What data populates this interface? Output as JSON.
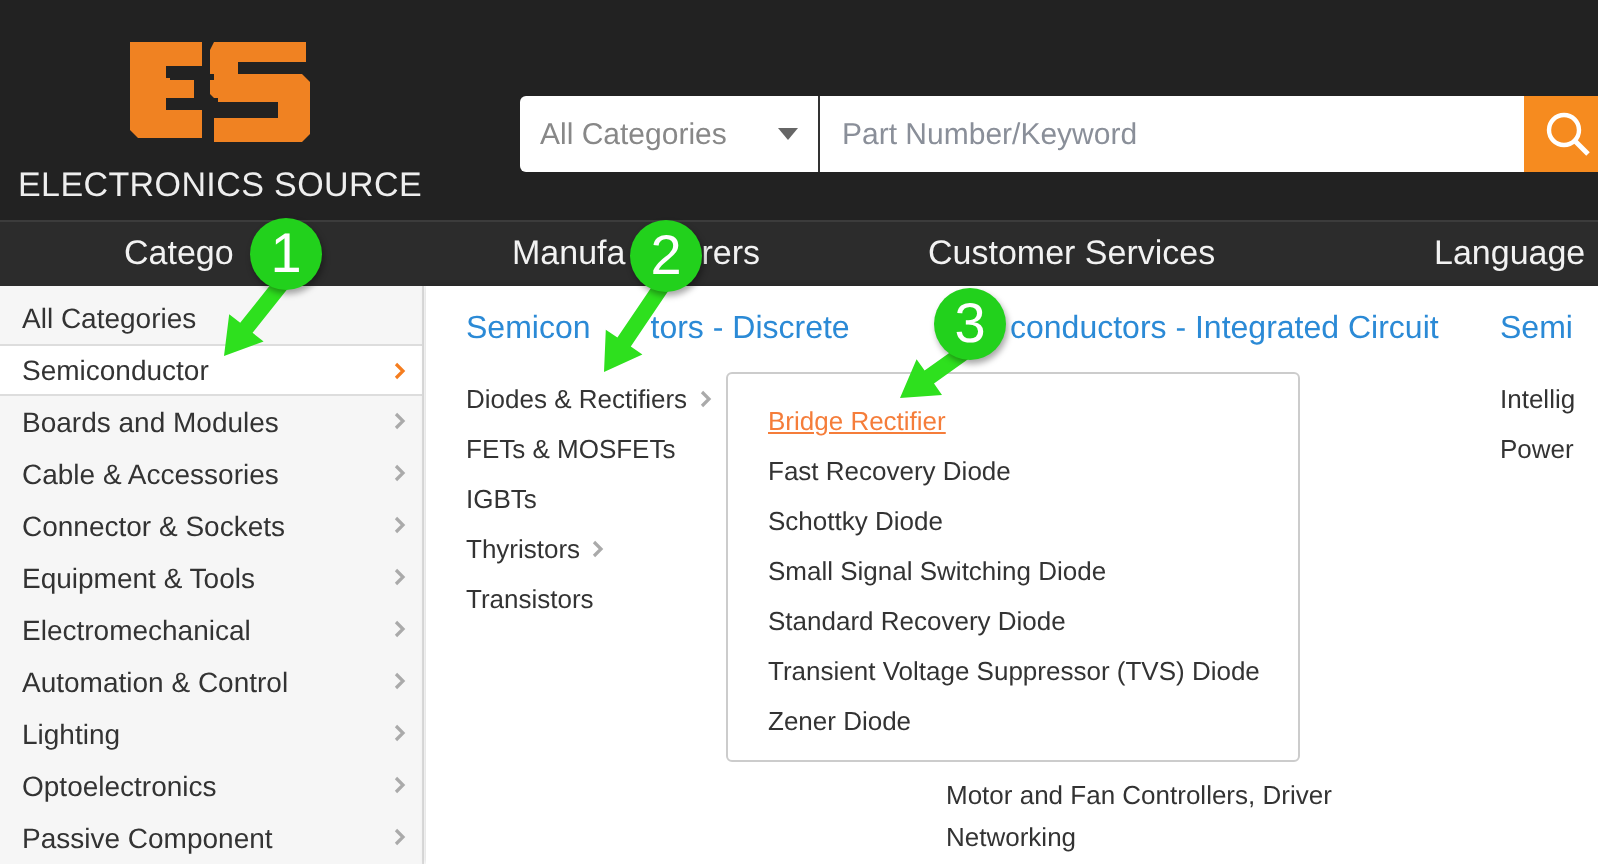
{
  "header": {
    "logo_text": "ELECTRONICS SOURCE",
    "search": {
      "category": "All Categories",
      "placeholder": "Part Number/Keyword"
    }
  },
  "nav": [
    {
      "parts": [
        "Catego"
      ]
    },
    {
      "parts": [
        "Manufa",
        "rers"
      ]
    },
    {
      "parts": [
        "Customer Services"
      ]
    },
    {
      "parts": [
        "Language"
      ]
    }
  ],
  "sidebar": {
    "items": [
      {
        "label": "All Categories",
        "kind": "plain",
        "selected": false
      },
      {
        "label": "Semiconductor",
        "kind": "submenu",
        "selected": true
      },
      {
        "label": "Boards and Modules",
        "kind": "submenu",
        "selected": false
      },
      {
        "label": "Cable & Accessories",
        "kind": "submenu",
        "selected": false
      },
      {
        "label": "Connector & Sockets",
        "kind": "submenu",
        "selected": false
      },
      {
        "label": "Equipment & Tools",
        "kind": "submenu",
        "selected": false
      },
      {
        "label": "Electromechanical",
        "kind": "submenu",
        "selected": false
      },
      {
        "label": "Automation & Control",
        "kind": "submenu",
        "selected": false
      },
      {
        "label": "Lighting",
        "kind": "submenu",
        "selected": false
      },
      {
        "label": "Optoelectronics",
        "kind": "submenu",
        "selected": false
      },
      {
        "label": "Passive Component",
        "kind": "submenu",
        "selected": false
      }
    ]
  },
  "mega_menu": {
    "columns": [
      {
        "title_parts": [
          "Semicon",
          "tors - Discrete"
        ],
        "items": [
          {
            "label": "Diodes & Rectifiers",
            "kind": "submenu"
          },
          {
            "label": "FETs & MOSFETs",
            "kind": "plain"
          },
          {
            "label": "IGBTs",
            "kind": "plain"
          },
          {
            "label": "Thyristors",
            "kind": "submenu"
          },
          {
            "label": "Transistors",
            "kind": "plain"
          }
        ]
      },
      {
        "title_parts": [
          "conductors - Integrated Circuit"
        ],
        "items": [
          {
            "label": "Motor and Fan Controllers, Driver",
            "kind": "plain"
          },
          {
            "label": "Networking",
            "kind": "plain"
          }
        ]
      },
      {
        "title_parts": [
          "Semi"
        ],
        "items": [
          {
            "label": "Intellig",
            "kind": "plain"
          },
          {
            "label": "Power",
            "kind": "plain"
          }
        ]
      }
    ]
  },
  "flyout": {
    "items": [
      {
        "label": "Bridge Rectifier",
        "selected": true
      },
      {
        "label": "Fast Recovery Diode",
        "selected": false
      },
      {
        "label": "Schottky Diode",
        "selected": false
      },
      {
        "label": "Small Signal Switching Diode",
        "selected": false
      },
      {
        "label": "Standard Recovery Diode",
        "selected": false
      },
      {
        "label": "Transient Voltage Suppressor (TVS) Diode",
        "selected": false
      },
      {
        "label": "Zener Diode",
        "selected": false
      }
    ]
  },
  "annotations": [
    {
      "number": "1"
    },
    {
      "number": "2"
    },
    {
      "number": "3"
    }
  ]
}
